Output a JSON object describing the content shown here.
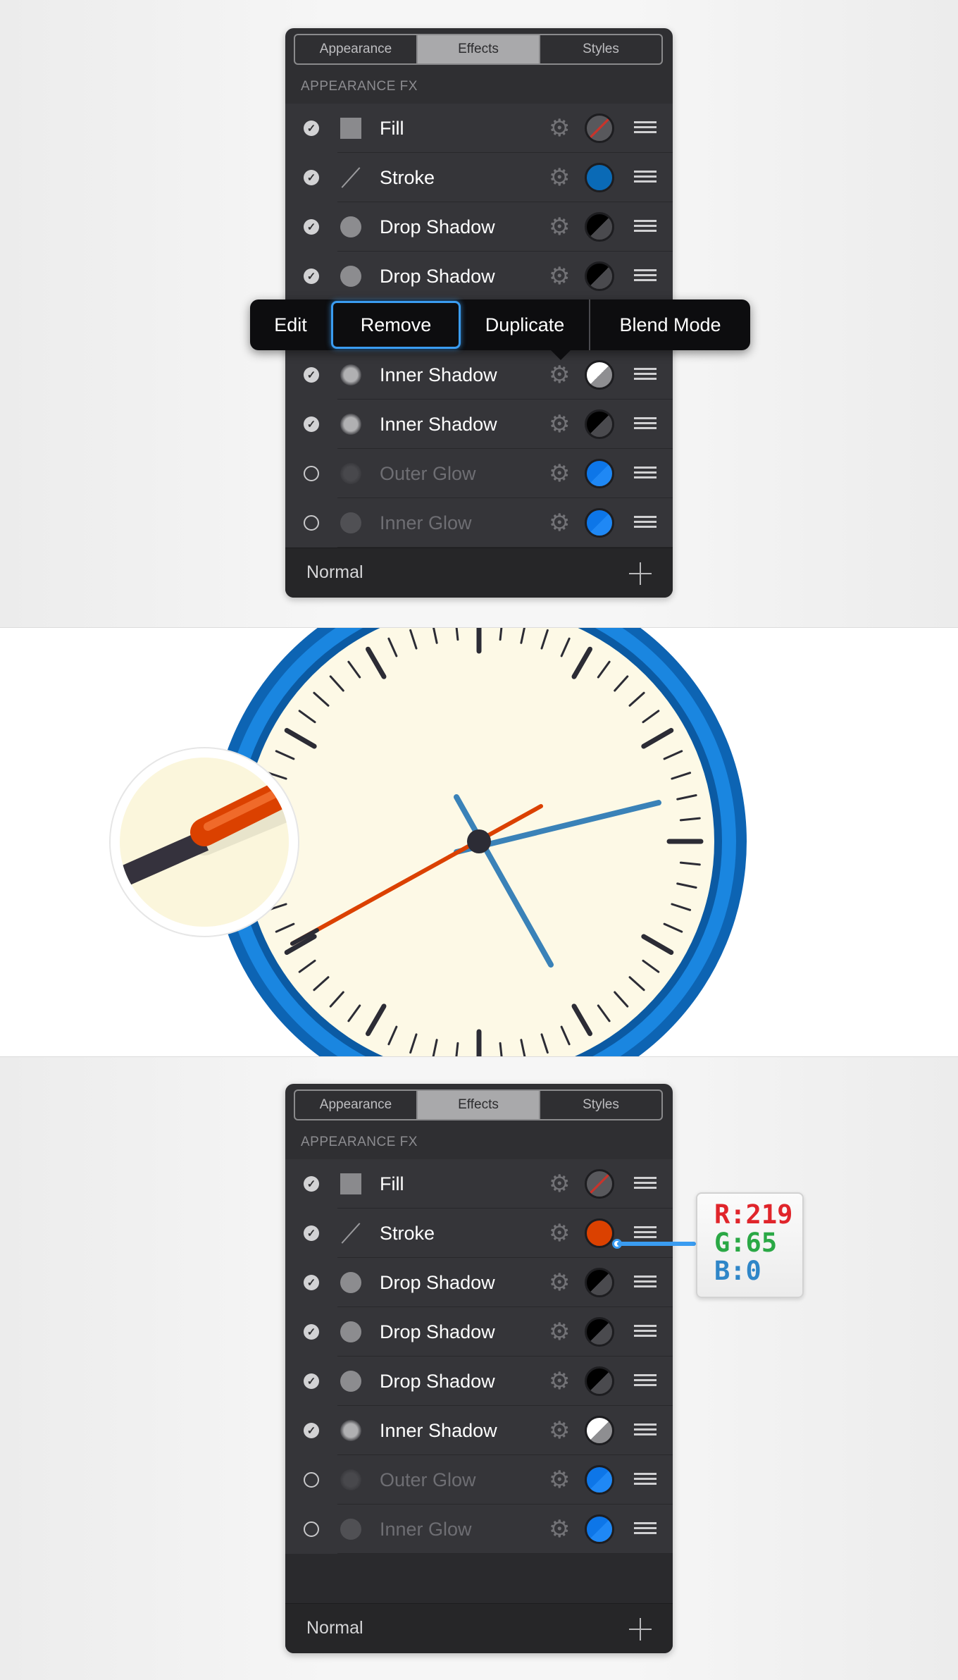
{
  "panel1": {
    "tabs": [
      "Appearance",
      "Effects",
      "Styles"
    ],
    "active_tab": "Effects",
    "section_title": "APPEARANCE FX",
    "rows": [
      {
        "label": "Fill",
        "enabled": true,
        "icon": "square-icon",
        "swatch": "none"
      },
      {
        "label": "Stroke",
        "enabled": true,
        "icon": "line-icon",
        "swatch": "#0a6ab6"
      },
      {
        "label": "Drop Shadow",
        "enabled": true,
        "icon": "circle-icon",
        "swatch": "black"
      },
      {
        "label": "Drop Shadow",
        "enabled": true,
        "icon": "circle-icon",
        "swatch": "black"
      },
      {
        "label": "",
        "enabled": true,
        "icon": "circle-icon",
        "swatch": "black"
      },
      {
        "label": "Inner Shadow",
        "enabled": true,
        "icon": "inner-circle-icon",
        "swatch": "white"
      },
      {
        "label": "Inner Shadow",
        "enabled": true,
        "icon": "inner-circle-icon",
        "swatch": "black"
      },
      {
        "label": "Outer Glow",
        "enabled": false,
        "icon": "glow-icon",
        "swatch": "#0d76e8"
      },
      {
        "label": "Inner Glow",
        "enabled": false,
        "icon": "glow-icon",
        "swatch": "#0d76e8"
      }
    ],
    "footer_label": "Normal"
  },
  "context_menu": {
    "items": [
      "Edit",
      "Remove",
      "Duplicate",
      "Blend Mode"
    ],
    "selected": "Remove"
  },
  "panel2": {
    "tabs": [
      "Appearance",
      "Effects",
      "Styles"
    ],
    "active_tab": "Effects",
    "section_title": "APPEARANCE FX",
    "rows": [
      {
        "label": "Fill",
        "enabled": true,
        "icon": "square-icon",
        "swatch": "none"
      },
      {
        "label": "Stroke",
        "enabled": true,
        "icon": "line-icon",
        "swatch": "#db4100"
      },
      {
        "label": "Drop Shadow",
        "enabled": true,
        "icon": "circle-icon",
        "swatch": "black"
      },
      {
        "label": "Drop Shadow",
        "enabled": true,
        "icon": "circle-icon",
        "swatch": "black"
      },
      {
        "label": "Drop Shadow",
        "enabled": true,
        "icon": "circle-icon",
        "swatch": "black"
      },
      {
        "label": "Inner Shadow",
        "enabled": true,
        "icon": "inner-circle-icon",
        "swatch": "white"
      },
      {
        "label": "Outer Glow",
        "enabled": false,
        "icon": "glow-icon",
        "swatch": "#0d76e8"
      },
      {
        "label": "Inner Glow",
        "enabled": false,
        "icon": "glow-icon",
        "swatch": "#0d76e8"
      }
    ],
    "footer_label": "Normal"
  },
  "rgb": {
    "r": "R:219",
    "g": "G:65",
    "b": "B:0",
    "r_color": "#e0252b",
    "g_color": "#2aa845",
    "b_color": "#2f86c8"
  },
  "colors": {
    "panel_bg": "#2f2f32",
    "accent_blue": "#3a9cf1",
    "clock_face": "#fdf9e6",
    "clock_ring": "#1a86e0",
    "second_hand": "#db4100",
    "hands": "#3a82b8",
    "ticks": "#2c2c35"
  }
}
